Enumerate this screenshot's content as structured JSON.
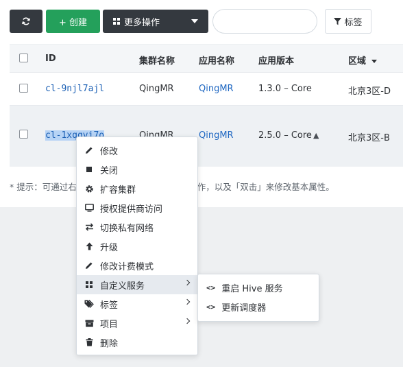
{
  "toolbar": {
    "refresh_icon": "refresh-icon",
    "create_label": "+ 创建",
    "more_label": "更多操作",
    "search_placeholder": "",
    "tag_label": "标签"
  },
  "table": {
    "headers": {
      "id": "ID",
      "cluster_name": "集群名称",
      "app_name": "应用名称",
      "app_version": "应用版本",
      "zone": "区域"
    },
    "rows": [
      {
        "id": "cl-9njl7ajl",
        "cluster_name": "QingMR",
        "app_name": "QingMR",
        "app_version": "1.3.0 – Core",
        "zone": "北京3区-D"
      },
      {
        "id": "cl-1xqqvi7o",
        "cluster_name": "QingMR",
        "app_name": "QingMR",
        "app_version": "2.5.0 – Core",
        "zone": "北京3区-B"
      }
    ]
  },
  "hint": {
    "left": "* 提示：可通过右",
    "right": "行常用操作，以及「双击」来修改基本属性。"
  },
  "context_menu": {
    "items": [
      {
        "label": "修改",
        "icon": "pencil-icon"
      },
      {
        "label": "关闭",
        "icon": "stop-icon"
      },
      {
        "label": "扩容集群",
        "icon": "gear-icon"
      },
      {
        "label": "授权提供商访问",
        "icon": "monitor-icon"
      },
      {
        "label": "切换私有网络",
        "icon": "switch-arrows-icon"
      },
      {
        "label": "升级",
        "icon": "arrow-up-icon"
      },
      {
        "label": "修改计费模式",
        "icon": "pencil-icon"
      },
      {
        "label": "自定义服务",
        "icon": "grid-dots-icon"
      },
      {
        "label": "标签",
        "icon": "tags-icon"
      },
      {
        "label": "项目",
        "icon": "folder-icon"
      },
      {
        "label": "删除",
        "icon": "trash-icon"
      }
    ]
  },
  "submenu": {
    "items": [
      {
        "label": "重启 Hive 服务",
        "icon": "code-icon"
      },
      {
        "label": "更新调度器",
        "icon": "code-icon"
      }
    ]
  },
  "colors": {
    "dark_button": "#34393f",
    "create_button": "#24a05b",
    "link": "#2068c2",
    "selected_row": "#eef1f4",
    "text_selection": "#b6d3f5"
  }
}
